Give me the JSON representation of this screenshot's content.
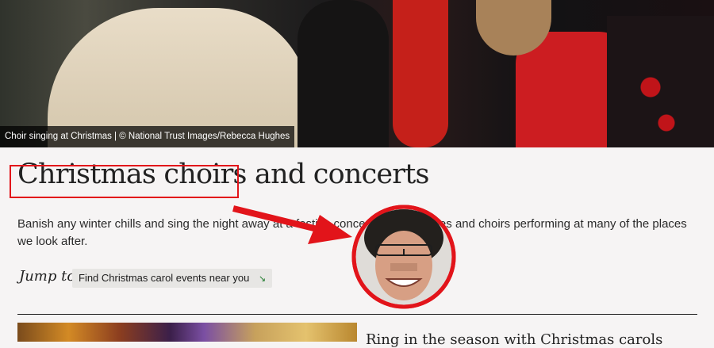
{
  "hero": {
    "caption": "Choir singing at Christmas | © National Trust Images/Rebecca Hughes"
  },
  "page": {
    "title": "Christmas choirs and concerts",
    "intro": "Banish any winter chills and sing the night away at a festive concert, carol services and choirs performing at many of the places we look after."
  },
  "jump": {
    "label": "Jump to",
    "link_text": "Find Christmas carol events near you",
    "link_icon": "arrow-down-right-icon"
  },
  "card": {
    "title": "Ring in the season with Christmas carols"
  },
  "annotation": {
    "highlight_color": "#e2141a"
  }
}
